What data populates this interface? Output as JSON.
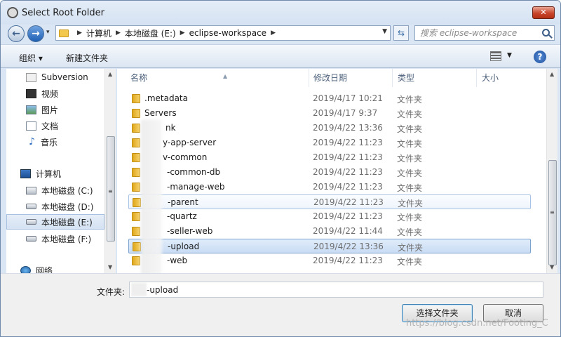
{
  "window": {
    "title": "Select Root Folder",
    "close_label": "✕"
  },
  "address": {
    "crumbs": [
      "计算机",
      "本地磁盘 (E:)",
      "eclipse-workspace"
    ],
    "search_placeholder": "搜索 eclipse-workspace"
  },
  "toolbar": {
    "organize": "组织 ▾",
    "new_folder": "新建文件夹",
    "help": "?"
  },
  "nav": {
    "items": [
      {
        "label": "Subversion",
        "icon": "subversion-icon"
      },
      {
        "label": "视频",
        "icon": "video-icon"
      },
      {
        "label": "图片",
        "icon": "pictures-icon"
      },
      {
        "label": "文档",
        "icon": "documents-icon"
      },
      {
        "label": "音乐",
        "icon": "music-icon"
      },
      {
        "label": "计算机",
        "icon": "computer-icon"
      },
      {
        "label": "本地磁盘 (C:)",
        "icon": "drive-icon"
      },
      {
        "label": "本地磁盘 (D:)",
        "icon": "drive-icon"
      },
      {
        "label": "本地磁盘 (E:)",
        "icon": "drive-icon",
        "selected": true
      },
      {
        "label": "本地磁盘 (F:)",
        "icon": "drive-icon"
      },
      {
        "label": "网络",
        "icon": "network-icon"
      }
    ]
  },
  "files": {
    "columns": [
      "名称",
      "修改日期",
      "类型",
      "大小"
    ],
    "rows": [
      {
        "name": ".metadata",
        "date": "2019/4/17 10:21",
        "type": "文件夹"
      },
      {
        "name": "Servers",
        "date": "2019/4/17 9:37",
        "type": "文件夹"
      },
      {
        "name": "nk",
        "date": "2019/4/22 13:36",
        "type": "文件夹"
      },
      {
        "name": "y-app-server",
        "date": "2019/4/22 11:23",
        "type": "文件夹"
      },
      {
        "name": "v-common",
        "date": "2019/4/22 11:23",
        "type": "文件夹"
      },
      {
        "name": "-common-db",
        "date": "2019/4/22 11:23",
        "type": "文件夹"
      },
      {
        "name": "-manage-web",
        "date": "2019/4/22 11:23",
        "type": "文件夹"
      },
      {
        "name": "-parent",
        "date": "2019/4/22 11:23",
        "type": "文件夹",
        "state": "hover"
      },
      {
        "name": "-quartz",
        "date": "2019/4/22 11:23",
        "type": "文件夹"
      },
      {
        "name": "-seller-web",
        "date": "2019/4/22 11:44",
        "type": "文件夹"
      },
      {
        "name": "-upload",
        "date": "2019/4/22 13:36",
        "type": "文件夹",
        "state": "selected"
      },
      {
        "name": "-web",
        "date": "2019/4/22 11:23",
        "type": "文件夹"
      }
    ]
  },
  "bottom": {
    "filename_label": "文件夹:",
    "filename_value": "-upload",
    "ok_label": "选择文件夹",
    "cancel_label": "取消",
    "watermark": "https://blog.csdn.net/Footing_C"
  }
}
